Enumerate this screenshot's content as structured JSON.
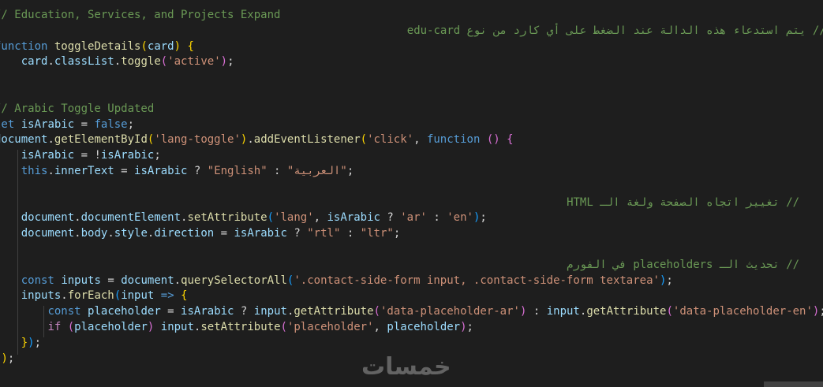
{
  "colors": {
    "background": "#1e1e1e",
    "comment": "#6a9955",
    "keyword": "#569cd6",
    "control": "#c586c0",
    "function": "#dcdcaa",
    "variable": "#9cdcfe",
    "string": "#ce9178",
    "default": "#d4d4d4",
    "bracket1": "#ffd700",
    "bracket2": "#da70d6",
    "bracket3": "#179fff",
    "type": "#4ec9b0"
  },
  "code_lines": [
    [
      {
        "t": "// Education, Services, and Projects Expand",
        "c": "comment"
      }
    ],
    [
      {
        "t": "// يتم استدعاء هذه الدالة عند الضغط على أي كارد من نوع edu-card",
        "c": "comment"
      }
    ],
    [
      {
        "t": "function",
        "c": "keyword"
      },
      {
        "t": " ",
        "c": "default"
      },
      {
        "t": "toggleDetails",
        "c": "function"
      },
      {
        "t": "(",
        "c": "bracket1"
      },
      {
        "t": "card",
        "c": "variable"
      },
      {
        "t": ")",
        "c": "bracket1"
      },
      {
        "t": " ",
        "c": "default"
      },
      {
        "t": "{",
        "c": "bracket1"
      }
    ],
    [
      {
        "t": "    ",
        "c": "default"
      },
      {
        "t": "card",
        "c": "variable"
      },
      {
        "t": ".",
        "c": "default"
      },
      {
        "t": "classList",
        "c": "variable"
      },
      {
        "t": ".",
        "c": "default"
      },
      {
        "t": "toggle",
        "c": "function"
      },
      {
        "t": "(",
        "c": "bracket2"
      },
      {
        "t": "'active'",
        "c": "string"
      },
      {
        "t": ")",
        "c": "bracket2"
      },
      {
        "t": ";",
        "c": "default"
      }
    ],
    [
      {
        "t": "}",
        "c": "bracket1"
      }
    ],
    [],
    [
      {
        "t": "// Arabic Toggle Updated",
        "c": "comment"
      }
    ],
    [
      {
        "t": "let",
        "c": "keyword"
      },
      {
        "t": " ",
        "c": "default"
      },
      {
        "t": "isArabic",
        "c": "variable"
      },
      {
        "t": " = ",
        "c": "default"
      },
      {
        "t": "false",
        "c": "keyword"
      },
      {
        "t": ";",
        "c": "default"
      }
    ],
    [
      {
        "t": "document",
        "c": "variable"
      },
      {
        "t": ".",
        "c": "default"
      },
      {
        "t": "getElementById",
        "c": "function"
      },
      {
        "t": "(",
        "c": "bracket1"
      },
      {
        "t": "'lang-toggle'",
        "c": "string"
      },
      {
        "t": ")",
        "c": "bracket1"
      },
      {
        "t": ".",
        "c": "default"
      },
      {
        "t": "addEventListener",
        "c": "function"
      },
      {
        "t": "(",
        "c": "bracket1"
      },
      {
        "t": "'click'",
        "c": "string"
      },
      {
        "t": ", ",
        "c": "default"
      },
      {
        "t": "function",
        "c": "keyword"
      },
      {
        "t": " ",
        "c": "default"
      },
      {
        "t": "()",
        "c": "bracket2"
      },
      {
        "t": " ",
        "c": "default"
      },
      {
        "t": "{",
        "c": "bracket2"
      }
    ],
    [
      {
        "t": "    ",
        "c": "default"
      },
      {
        "t": "isArabic",
        "c": "variable"
      },
      {
        "t": " = !",
        "c": "default"
      },
      {
        "t": "isArabic",
        "c": "variable"
      },
      {
        "t": ";",
        "c": "default"
      }
    ],
    [
      {
        "t": "    ",
        "c": "default"
      },
      {
        "t": "this",
        "c": "keyword"
      },
      {
        "t": ".",
        "c": "default"
      },
      {
        "t": "innerText",
        "c": "variable"
      },
      {
        "t": " = ",
        "c": "default"
      },
      {
        "t": "isArabic",
        "c": "variable"
      },
      {
        "t": " ? ",
        "c": "default"
      },
      {
        "t": "\"English\"",
        "c": "string"
      },
      {
        "t": " : ",
        "c": "default"
      },
      {
        "t": "\"العربية\"",
        "c": "string"
      },
      {
        "t": ";",
        "c": "default"
      }
    ],
    [],
    [
      {
        "t": "    ",
        "c": "default"
      },
      {
        "t": "// تغيير اتجاه الصفحة ولغة الـ HTML",
        "c": "comment"
      }
    ],
    [
      {
        "t": "    ",
        "c": "default"
      },
      {
        "t": "document",
        "c": "variable"
      },
      {
        "t": ".",
        "c": "default"
      },
      {
        "t": "documentElement",
        "c": "variable"
      },
      {
        "t": ".",
        "c": "default"
      },
      {
        "t": "setAttribute",
        "c": "function"
      },
      {
        "t": "(",
        "c": "bracket3"
      },
      {
        "t": "'lang'",
        "c": "string"
      },
      {
        "t": ", ",
        "c": "default"
      },
      {
        "t": "isArabic",
        "c": "variable"
      },
      {
        "t": " ? ",
        "c": "default"
      },
      {
        "t": "'ar'",
        "c": "string"
      },
      {
        "t": " : ",
        "c": "default"
      },
      {
        "t": "'en'",
        "c": "string"
      },
      {
        "t": ")",
        "c": "bracket3"
      },
      {
        "t": ";",
        "c": "default"
      }
    ],
    [
      {
        "t": "    ",
        "c": "default"
      },
      {
        "t": "document",
        "c": "variable"
      },
      {
        "t": ".",
        "c": "default"
      },
      {
        "t": "body",
        "c": "variable"
      },
      {
        "t": ".",
        "c": "default"
      },
      {
        "t": "style",
        "c": "variable"
      },
      {
        "t": ".",
        "c": "default"
      },
      {
        "t": "direction",
        "c": "variable"
      },
      {
        "t": " = ",
        "c": "default"
      },
      {
        "t": "isArabic",
        "c": "variable"
      },
      {
        "t": " ? ",
        "c": "default"
      },
      {
        "t": "\"rtl\"",
        "c": "string"
      },
      {
        "t": " : ",
        "c": "default"
      },
      {
        "t": "\"ltr\"",
        "c": "string"
      },
      {
        "t": ";",
        "c": "default"
      }
    ],
    [],
    [
      {
        "t": "    ",
        "c": "default"
      },
      {
        "t": "// تحديث الـ placeholders في الفورم",
        "c": "comment"
      }
    ],
    [
      {
        "t": "    ",
        "c": "default"
      },
      {
        "t": "const",
        "c": "keyword"
      },
      {
        "t": " ",
        "c": "default"
      },
      {
        "t": "inputs",
        "c": "variable"
      },
      {
        "t": " = ",
        "c": "default"
      },
      {
        "t": "document",
        "c": "variable"
      },
      {
        "t": ".",
        "c": "default"
      },
      {
        "t": "querySelectorAll",
        "c": "function"
      },
      {
        "t": "(",
        "c": "bracket3"
      },
      {
        "t": "'.contact-side-form input, .contact-side-form textarea'",
        "c": "string"
      },
      {
        "t": ")",
        "c": "bracket3"
      },
      {
        "t": ";",
        "c": "default"
      }
    ],
    [
      {
        "t": "    ",
        "c": "default"
      },
      {
        "t": "inputs",
        "c": "variable"
      },
      {
        "t": ".",
        "c": "default"
      },
      {
        "t": "forEach",
        "c": "function"
      },
      {
        "t": "(",
        "c": "bracket3"
      },
      {
        "t": "input",
        "c": "variable"
      },
      {
        "t": " ",
        "c": "default"
      },
      {
        "t": "=>",
        "c": "keyword"
      },
      {
        "t": " ",
        "c": "default"
      },
      {
        "t": "{",
        "c": "bracket1"
      }
    ],
    [
      {
        "t": "        ",
        "c": "default"
      },
      {
        "t": "const",
        "c": "keyword"
      },
      {
        "t": " ",
        "c": "default"
      },
      {
        "t": "placeholder",
        "c": "variable"
      },
      {
        "t": " = ",
        "c": "default"
      },
      {
        "t": "isArabic",
        "c": "variable"
      },
      {
        "t": " ? ",
        "c": "default"
      },
      {
        "t": "input",
        "c": "variable"
      },
      {
        "t": ".",
        "c": "default"
      },
      {
        "t": "getAttribute",
        "c": "function"
      },
      {
        "t": "(",
        "c": "bracket2"
      },
      {
        "t": "'data-placeholder-ar'",
        "c": "string"
      },
      {
        "t": ")",
        "c": "bracket2"
      },
      {
        "t": " : ",
        "c": "default"
      },
      {
        "t": "input",
        "c": "variable"
      },
      {
        "t": ".",
        "c": "default"
      },
      {
        "t": "getAttribute",
        "c": "function"
      },
      {
        "t": "(",
        "c": "bracket2"
      },
      {
        "t": "'data-placeholder-en'",
        "c": "string"
      },
      {
        "t": ")",
        "c": "bracket2"
      },
      {
        "t": ";",
        "c": "default"
      }
    ],
    [
      {
        "t": "        ",
        "c": "default"
      },
      {
        "t": "if",
        "c": "control"
      },
      {
        "t": " ",
        "c": "default"
      },
      {
        "t": "(",
        "c": "bracket2"
      },
      {
        "t": "placeholder",
        "c": "variable"
      },
      {
        "t": ")",
        "c": "bracket2"
      },
      {
        "t": " ",
        "c": "default"
      },
      {
        "t": "input",
        "c": "variable"
      },
      {
        "t": ".",
        "c": "default"
      },
      {
        "t": "setAttribute",
        "c": "function"
      },
      {
        "t": "(",
        "c": "bracket2"
      },
      {
        "t": "'placeholder'",
        "c": "string"
      },
      {
        "t": ", ",
        "c": "default"
      },
      {
        "t": "placeholder",
        "c": "variable"
      },
      {
        "t": ")",
        "c": "bracket2"
      },
      {
        "t": ";",
        "c": "default"
      }
    ],
    [
      {
        "t": "    ",
        "c": "default"
      },
      {
        "t": "}",
        "c": "bracket1"
      },
      {
        "t": ")",
        "c": "bracket3"
      },
      {
        "t": ";",
        "c": "default"
      }
    ],
    [
      {
        "t": "}",
        "c": "bracket2"
      },
      {
        "t": ")",
        "c": "bracket1"
      },
      {
        "t": ";",
        "c": "default"
      }
    ]
  ],
  "watermark": "خمسات"
}
